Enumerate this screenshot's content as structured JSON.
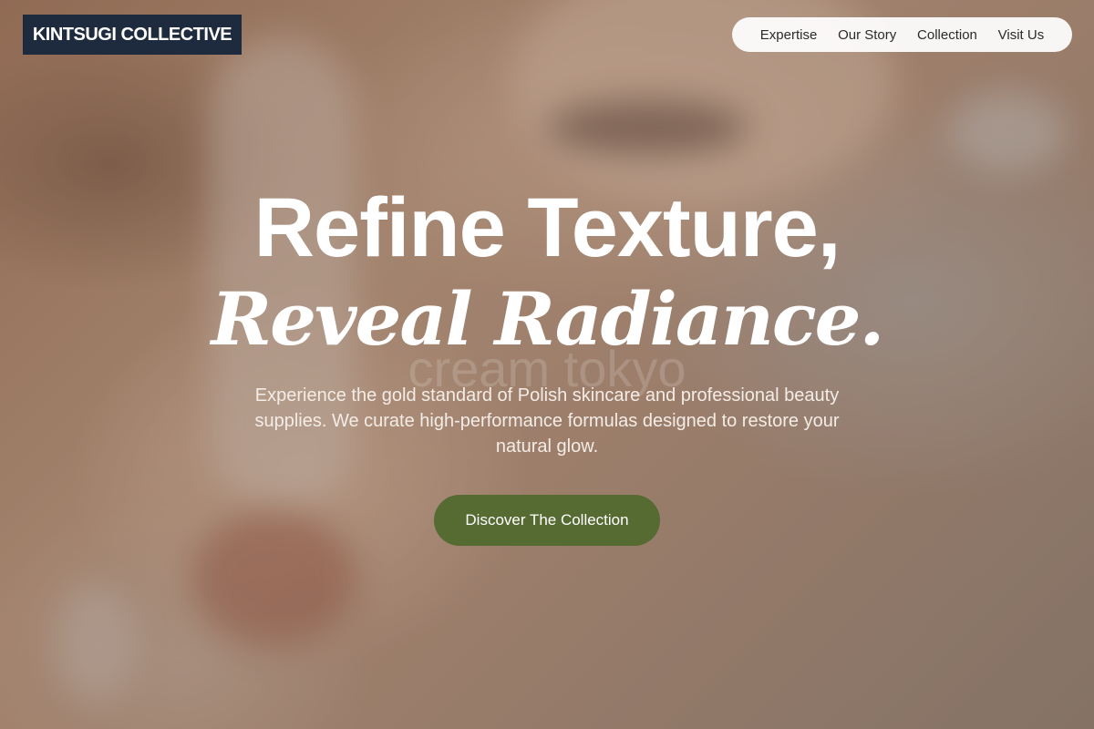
{
  "brand": {
    "name": "KINTSUGI COLLECTIVE"
  },
  "nav": {
    "items": [
      {
        "label": "Expertise"
      },
      {
        "label": "Our Story"
      },
      {
        "label": "Collection"
      },
      {
        "label": "Visit Us"
      }
    ]
  },
  "hero": {
    "headline_line1": "Refine Texture,",
    "headline_line2": "Reveal Radiance.",
    "watermark": "cream tokyo",
    "subtitle": "Experience the gold standard of Polish skincare and professional beauty supplies. We curate high-performance formulas designed to restore your natural glow.",
    "cta_label": "Discover The Collection"
  },
  "colors": {
    "brand_bg": "#1e2a3e",
    "cta_bg": "#556b32",
    "nav_bg": "#ffffff"
  }
}
